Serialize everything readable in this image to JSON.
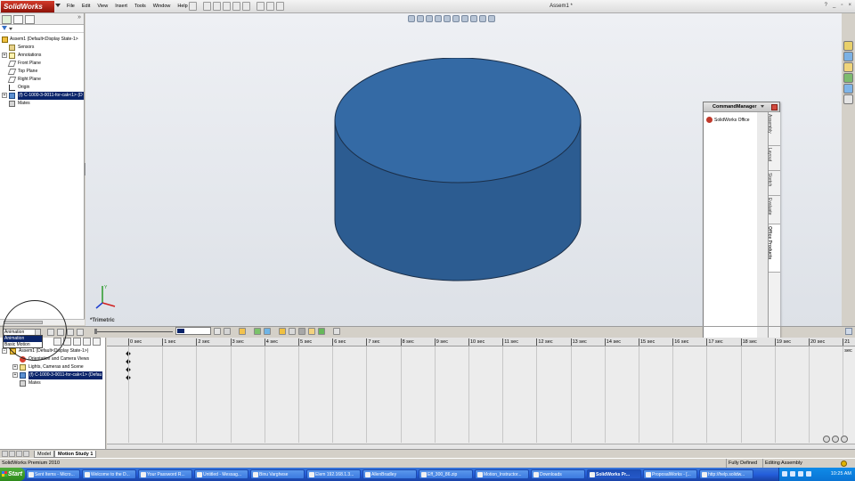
{
  "app": {
    "logo_text": "SolidWorks",
    "menus": [
      "File",
      "Edit",
      "View",
      "Insert",
      "Tools",
      "Window",
      "Help"
    ],
    "document_title": "Assem1 *",
    "window_controls": [
      "_",
      "▫",
      "×"
    ]
  },
  "feature_tree": {
    "root": "Assem1  (Default<Display State-1>",
    "items": [
      {
        "label": "Sensors",
        "icon": "sensor-icon"
      },
      {
        "label": "Annotations",
        "icon": "annotation-icon"
      },
      {
        "label": "Front Plane",
        "icon": "plane-icon"
      },
      {
        "label": "Top Plane",
        "icon": "plane-icon"
      },
      {
        "label": "Right Plane",
        "icon": "plane-icon"
      },
      {
        "label": "Origin",
        "icon": "origin-icon"
      },
      {
        "label": "(f) C-1000-3-0011-for-cak<1> (D",
        "icon": "part-icon"
      },
      {
        "label": "Mates",
        "icon": "mates-icon"
      }
    ]
  },
  "viewport": {
    "view_label": "*Trimetric",
    "model_color": "#2f6aa8"
  },
  "command_manager": {
    "title": "CommandManager",
    "row_label": "SolidWorks Office",
    "tabs": [
      "Assembly",
      "Layout",
      "Sketch",
      "Evaluate",
      "Office Products"
    ],
    "active_tab": "Office Products"
  },
  "motion_study": {
    "study_type": "Animation",
    "study_type_options": [
      "Animation",
      "Basic Motion"
    ],
    "tree": {
      "root": "Assem1  (Default<Display State-1>)",
      "items": [
        {
          "label": "Orientation and Camera Views"
        },
        {
          "label": "Lights, Cameras and Scene"
        },
        {
          "label": "(f) C-1000-3-0011-for-cak<1> (Defau"
        },
        {
          "label": "Mates"
        }
      ]
    },
    "time_ticks": [
      "0 sec",
      "1 sec",
      "2 sec",
      "3 sec",
      "4 sec",
      "5 sec",
      "6 sec",
      "7 sec",
      "8 sec",
      "9 sec",
      "10 sec",
      "11 sec",
      "12 sec",
      "13 sec",
      "14 sec",
      "15 sec",
      "16 sec",
      "17 sec",
      "18 sec",
      "19 sec",
      "20 sec",
      "21 sec"
    ],
    "bottom_tabs": [
      "Model",
      "Motion Study 1"
    ],
    "active_bottom_tab": "Motion Study 1"
  },
  "status_bar": {
    "product": "SolidWorks Premium 2010",
    "state": "Fully Defined",
    "mode": "Editing Assembly"
  },
  "taskbar": {
    "start_label": "Start",
    "tasks": [
      {
        "label": "Sent Items - Micro..."
      },
      {
        "label": "Welcome to the D..."
      },
      {
        "label": "Your Password R..."
      },
      {
        "label": "Untitled - Messag..."
      },
      {
        "label": "Binu Varghese"
      },
      {
        "label": "Elem 192.168.1.3..."
      },
      {
        "label": "AllenBradley"
      },
      {
        "label": "Eff_300_86.zip"
      },
      {
        "label": "Motion_Instructor..."
      },
      {
        "label": "Downloads"
      },
      {
        "label": "SolidWorks Pr..."
      },
      {
        "label": "ProposalWorks - [..."
      },
      {
        "label": "http://help.solidw..."
      }
    ],
    "active_task_index": 10,
    "clock": "10:25 AM"
  }
}
